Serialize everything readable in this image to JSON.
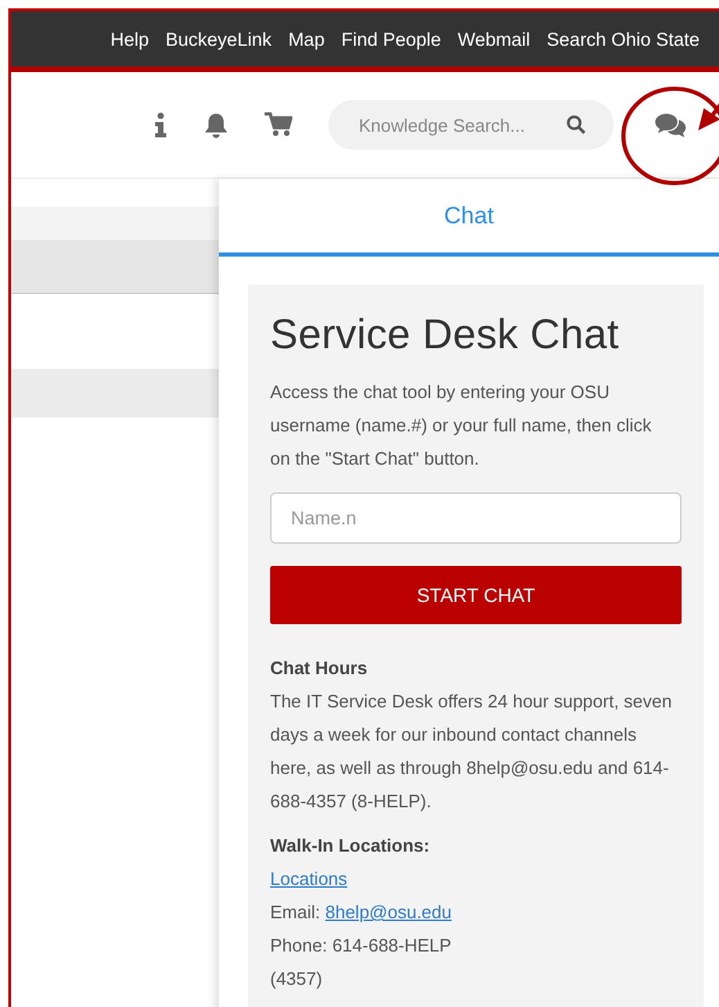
{
  "top_links": [
    "Help",
    "BuckeyeLink",
    "Map",
    "Find People",
    "Webmail",
    "Search Ohio State"
  ],
  "header": {
    "search": {
      "placeholder": "Knowledge Search..."
    }
  },
  "annotation": {
    "kind": "circle-arrow"
  },
  "tabs": [
    {
      "label": "Chat",
      "selected": true
    }
  ],
  "card": {
    "title": "Service Desk Chat",
    "intro": "Access the chat tool by entering your OSU username (name.#) or your full name, then click on the \"Start Chat\" button.",
    "name_field": {
      "placeholder": "Name.n"
    },
    "button": "START CHAT",
    "hours": {
      "heading": "Chat Hours",
      "text": "The IT Service Desk offers 24 hour support, seven days a week for our inbound contact channels here, as well as through 8help@osu.edu and 614-688-4357 (8-HELP)."
    },
    "walk_in": {
      "heading": "Walk-In Locations:",
      "lines": [
        {
          "kind": "link",
          "text": "Locations"
        },
        {
          "kind": "email",
          "label": "Email:",
          "link": "8help@osu.edu"
        },
        {
          "kind": "text",
          "text": "Phone: 614-688-HELP"
        },
        {
          "kind": "text",
          "text": "(4357)"
        }
      ]
    }
  }
}
